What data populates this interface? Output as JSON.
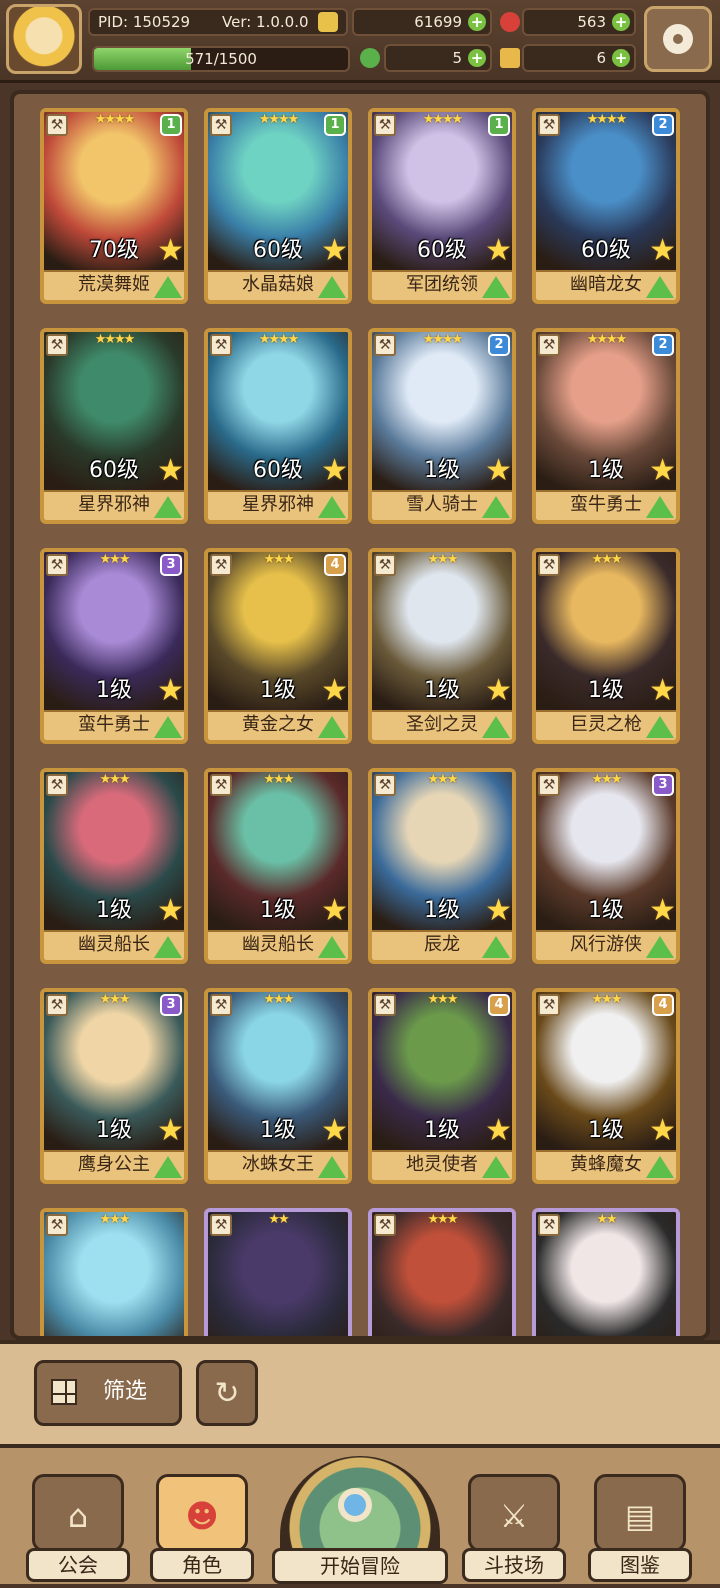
{
  "header": {
    "pid_label": "PID: 150529",
    "version_label": "Ver: 1.0.0.0",
    "gold": "61699",
    "ruby": "563",
    "clover": "5",
    "ticket": "6",
    "exp": "571/1500",
    "exp_fraction": 0.38
  },
  "roster": [
    {
      "level": "70级",
      "name": "荒漠舞姬",
      "stars": "★★★★",
      "tier": "1",
      "tier_color": "#5ab04a",
      "frame": "gold",
      "portrait": [
        "#f2c56a",
        "#c04a3a"
      ]
    },
    {
      "level": "60级",
      "name": "水晶菇娘",
      "stars": "★★★★",
      "tier": "1",
      "tier_color": "#5ab04a",
      "frame": "gold",
      "portrait": [
        "#6fd3c3",
        "#3a7fa8"
      ]
    },
    {
      "level": "60级",
      "name": "军团统领",
      "stars": "★★★★",
      "tier": "1",
      "tier_color": "#5ab04a",
      "frame": "gold",
      "portrait": [
        "#cfc2e6",
        "#5a4a7a"
      ]
    },
    {
      "level": "60级",
      "name": "幽暗龙女",
      "stars": "★★★★",
      "tier": "2",
      "tier_color": "#3d8ad8",
      "frame": "gold",
      "portrait": [
        "#4a8fc8",
        "#2a3a5a"
      ]
    },
    {
      "level": "60级",
      "name": "星界邪神",
      "stars": "★★★★",
      "tier": "",
      "tier_color": "#5a4aa8",
      "frame": "gold",
      "portrait": [
        "#3f8a6a",
        "#2a3a2a"
      ]
    },
    {
      "level": "60级",
      "name": "星界邪神",
      "stars": "★★★★",
      "tier": "",
      "tier_color": "#3d8ad8",
      "frame": "gold",
      "portrait": [
        "#8fd6e6",
        "#2a6a8a"
      ]
    },
    {
      "level": "1级",
      "name": "雪人骑士",
      "stars": "★★★★",
      "tier": "2",
      "tier_color": "#3d8ad8",
      "frame": "gold",
      "portrait": [
        "#dfeaf6",
        "#5a7a9a"
      ]
    },
    {
      "level": "1级",
      "name": "蛮牛勇士",
      "stars": "★★★★",
      "tier": "2",
      "tier_color": "#3d8ad8",
      "frame": "gold",
      "portrait": [
        "#e6a08a",
        "#6a4a3a"
      ]
    },
    {
      "level": "1级",
      "name": "蛮牛勇士",
      "stars": "★★★",
      "tier": "3",
      "tier_color": "#8a5ac8",
      "frame": "gold",
      "portrait": [
        "#a98ad6",
        "#3a2a5a"
      ]
    },
    {
      "level": "1级",
      "name": "黄金之女",
      "stars": "★★★",
      "tier": "4",
      "tier_color": "#d8a04a",
      "frame": "gold",
      "portrait": [
        "#e6c04a",
        "#5a4a2a"
      ]
    },
    {
      "level": "1级",
      "name": "圣剑之灵",
      "stars": "★★★",
      "tier": "",
      "tier_color": "#5ab04a",
      "frame": "gold",
      "portrait": [
        "#dfe6ee",
        "#6a5a3a"
      ]
    },
    {
      "level": "1级",
      "name": "巨灵之枪",
      "stars": "★★★",
      "tier": "",
      "tier_color": "#5ab04a",
      "frame": "gold",
      "portrait": [
        "#e8b860",
        "#3a2a2a"
      ]
    },
    {
      "level": "1级",
      "name": "幽灵船长",
      "stars": "★★★",
      "tier": "",
      "tier_color": "#5ab04a",
      "frame": "gold",
      "portrait": [
        "#d86a7a",
        "#2a4a4a"
      ]
    },
    {
      "level": "1级",
      "name": "幽灵船长",
      "stars": "★★★",
      "tier": "",
      "tier_color": "#5ab04a",
      "frame": "gold",
      "portrait": [
        "#6ac0a6",
        "#5a2a2a"
      ]
    },
    {
      "level": "1级",
      "name": "辰龙",
      "stars": "★★★",
      "tier": "",
      "tier_color": "#5ab04a",
      "frame": "gold",
      "portrait": [
        "#e6d6b6",
        "#3a6a9a"
      ]
    },
    {
      "level": "1级",
      "name": "风行游侠",
      "stars": "★★★",
      "tier": "3",
      "tier_color": "#8a5ac8",
      "frame": "gold",
      "portrait": [
        "#e6e6ee",
        "#5a3a2a"
      ]
    },
    {
      "level": "1级",
      "name": "鹰身公主",
      "stars": "★★★",
      "tier": "3",
      "tier_color": "#8a5ac8",
      "frame": "gold",
      "portrait": [
        "#f0d6a6",
        "#3a5a5a"
      ]
    },
    {
      "level": "1级",
      "name": "冰蛛女王",
      "stars": "★★★",
      "tier": "",
      "tier_color": "#5ab04a",
      "frame": "gold",
      "portrait": [
        "#8ad6e6",
        "#3a5a7a"
      ]
    },
    {
      "level": "1级",
      "name": "地灵使者",
      "stars": "★★★",
      "tier": "4",
      "tier_color": "#d8a04a",
      "frame": "gold",
      "portrait": [
        "#6a9a4a",
        "#3a2a4a"
      ]
    },
    {
      "level": "1级",
      "name": "黄蜂魔女",
      "stars": "★★★",
      "tier": "4",
      "tier_color": "#d8a04a",
      "frame": "gold",
      "portrait": [
        "#f0f0f0",
        "#6a4a1a"
      ]
    },
    {
      "level": "",
      "name": "",
      "stars": "★★★",
      "tier": "",
      "tier_color": "#5ab04a",
      "frame": "gold",
      "portrait": [
        "#9ee0f0",
        "#4a8aa6"
      ]
    },
    {
      "level": "",
      "name": "",
      "stars": "★★",
      "tier": "",
      "tier_color": "#5ab04a",
      "frame": "purple",
      "portrait": [
        "#4a3a6a",
        "#2a2a3a"
      ]
    },
    {
      "level": "",
      "name": "",
      "stars": "★★★",
      "tier": "",
      "tier_color": "#5ab04a",
      "frame": "purple",
      "portrait": [
        "#c0503a",
        "#3a2a2a"
      ]
    },
    {
      "level": "",
      "name": "",
      "stars": "★★",
      "tier": "",
      "tier_color": "#5ab04a",
      "frame": "purple",
      "portrait": [
        "#f0e6e6",
        "#2a2a2a"
      ]
    }
  ],
  "filter": {
    "label": "筛选"
  },
  "nav": {
    "guild": "公会",
    "character": "角色",
    "adventure": "开始冒险",
    "arena": "斗技场",
    "codex": "图鉴"
  }
}
